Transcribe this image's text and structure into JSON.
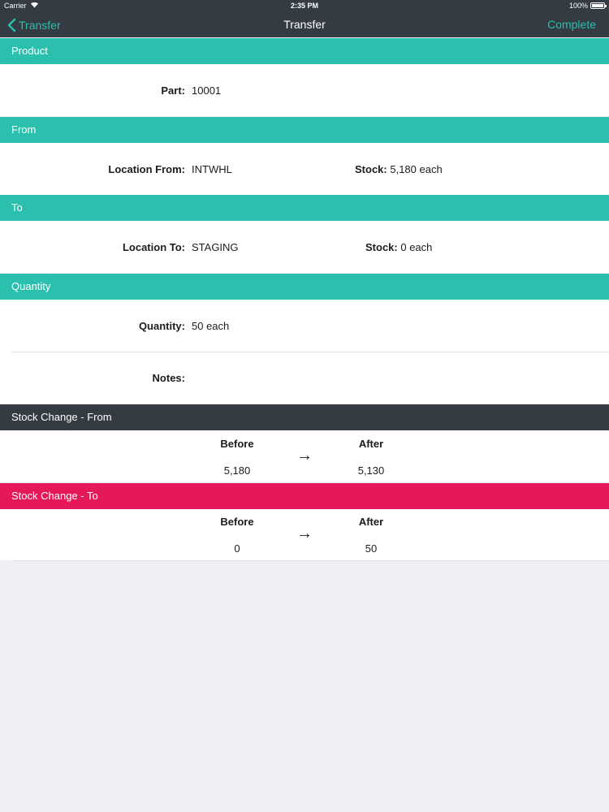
{
  "status_bar": {
    "carrier": "Carrier",
    "time": "2:35 PM",
    "battery": "100%"
  },
  "nav": {
    "back_label": "Transfer",
    "title": "Transfer",
    "action_label": "Complete"
  },
  "product": {
    "header": "Product",
    "part_label": "Part:",
    "part_value": "10001"
  },
  "from": {
    "header": "From",
    "location_label": "Location From:",
    "location_value": "INTWHL",
    "stock_label": "Stock:",
    "stock_value": "5,180 each"
  },
  "to": {
    "header": "To",
    "location_label": "Location To:",
    "location_value": "STAGING",
    "stock_label": "Stock:",
    "stock_value": "0 each"
  },
  "quantity": {
    "header": "Quantity",
    "quantity_label": "Quantity:",
    "quantity_value": "50 each",
    "notes_label": "Notes:",
    "notes_value": ""
  },
  "stock_change_from": {
    "header": "Stock Change - From",
    "before_label": "Before",
    "after_label": "After",
    "before_value": "5,180",
    "after_value": "5,130",
    "arrow": "→"
  },
  "stock_change_to": {
    "header": "Stock Change - To",
    "before_label": "Before",
    "after_label": "After",
    "before_value": "0",
    "after_value": "50",
    "arrow": "→"
  },
  "colors": {
    "accent": "#2bbfad",
    "dark_header": "#343b42",
    "alert_header": "#e5195a",
    "background": "#efeff4"
  }
}
